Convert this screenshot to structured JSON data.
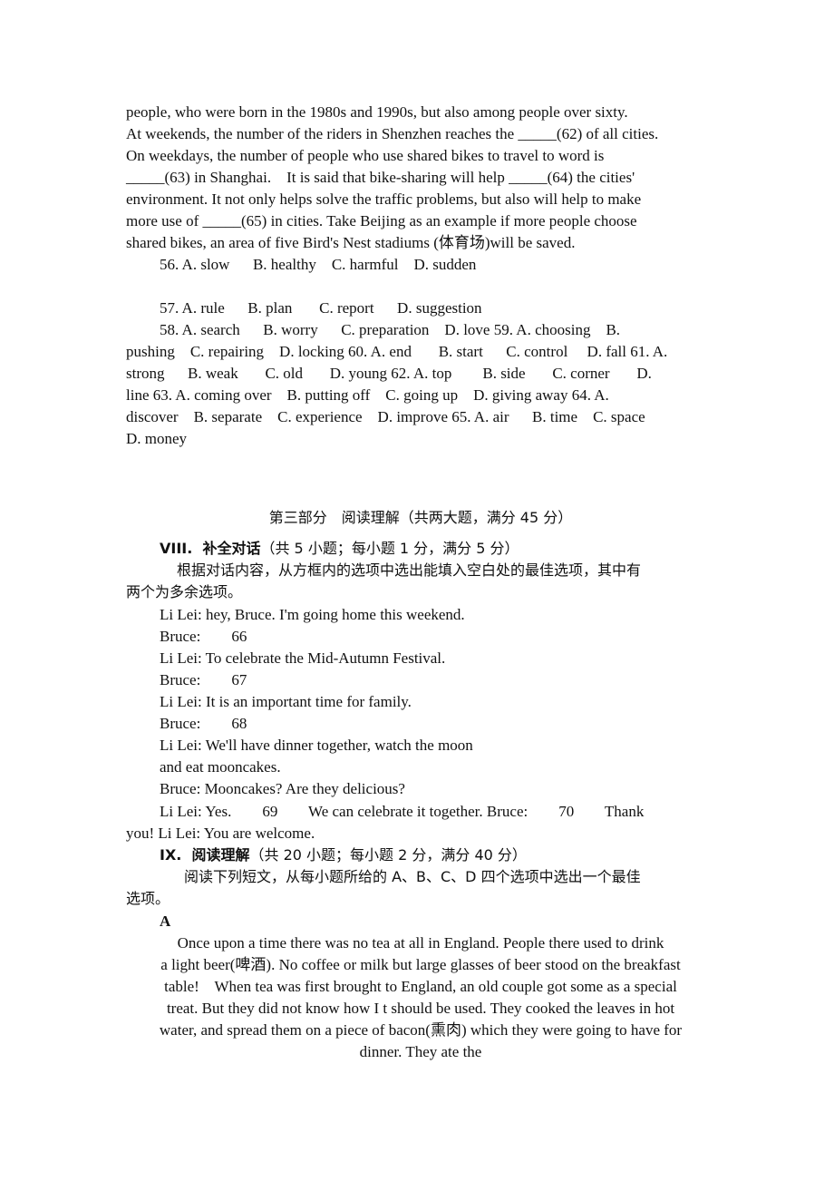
{
  "passage_top": [
    "people, who were born in the 1980s and 1990s, but also among people over sixty.",
    "At weekends, the number of the riders in Shenzhen reaches the _____(62) of all cities.",
    "On weekdays, the number of people who use shared bikes to travel to word is",
    "_____(63) in Shanghai.    It is said that bike-sharing will help _____(64) the cities'",
    "environment. It not only helps solve the traffic problems, but also will help to make",
    "more use of _____(65) in cities. Take Beijing as an example if more people choose",
    "shared bikes, an area of five Bird's Nest stadiums (体育场)will be saved."
  ],
  "options": [
    "56. A. slow      B. healthy    C. harmful    D. sudden",
    "57. A. rule      B. plan       C. report      D. suggestion",
    "58. A. search      B. worry      C. preparation    D. love 59. A. choosing    B.",
    "pushing    C. repairing    D. locking 60. A. end       B. start      C. control     D. fall 61. A.",
    "strong      B. weak       C. old       D. young 62. A. top        B. side       C. corner       D.",
    "line 63. A. coming over    B. putting off    C. going up    D. giving away 64. A.",
    "discover    B. separate    C. experience    D. improve 65. A. air      B. time    C. space",
    "D. money"
  ],
  "part3_title": "第三部分　阅读理解（共两大题，满分 45 分）",
  "section8": {
    "heading_bold": "VIII.  补全对话",
    "heading_rest": "（共 5 小题；每小题 1 分，满分 5 分）",
    "instr_1": "根据对话内容，从方框内的选项中选出能填入空白处的最佳选项，其中有",
    "instr_2": "两个为多余选项。",
    "dialogue": [
      "Li Lei: hey, Bruce. I'm going home this weekend.",
      "Bruce:        66",
      "Li Lei: To celebrate the Mid-Autumn Festival.",
      "Bruce:        67",
      "Li Lei: It is an important time for family.",
      "Bruce:        68",
      "Li Lei: We'll have dinner together, watch the moon",
      "and eat mooncakes.",
      "Bruce: Mooncakes? Are they delicious?",
      "Li Lei: Yes.        69        We can celebrate it together. Bruce:        70        Thank"
    ],
    "dialogue_wrap": "you! Li Lei: You are welcome."
  },
  "section9": {
    "heading_bold": "IX.  阅读理解",
    "heading_rest": "（共 20 小题；每小题 2 分，满分 40 分）",
    "instr_1": "阅读下列短文，从每小题所给的 A、B、C、D 四个选项中选出一个最佳",
    "instr_2": "选项。",
    "passage_label": "A",
    "passage": [
      "Once upon a time there was no tea at all in England. People there used to drink",
      "a light beer(啤酒). No coffee or milk but large glasses of beer stood on the breakfast",
      "table!    When tea was first brought to England, an old couple got some as a special",
      "treat. But they did not know how I t should be used. They cooked the leaves in hot",
      "water, and spread them on a piece of bacon(熏肉) which they were going to have for",
      "dinner. They ate the"
    ]
  }
}
